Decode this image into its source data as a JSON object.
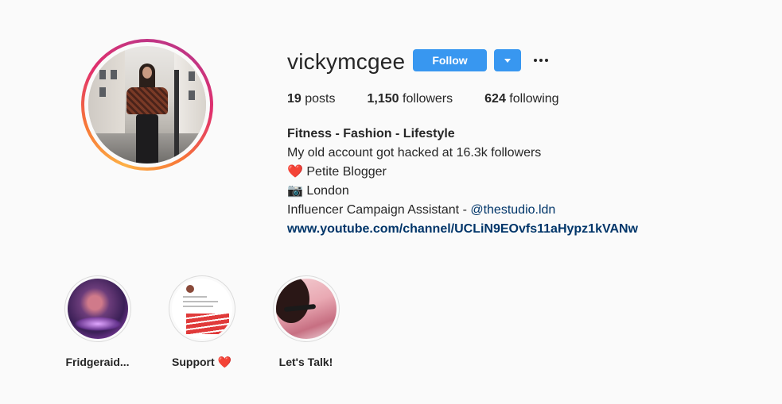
{
  "profile": {
    "username": "vickymcgee",
    "follow_label": "Follow",
    "stats": {
      "posts_count": "19",
      "posts_label": "posts",
      "followers_count": "1,150",
      "followers_label": "followers",
      "following_count": "624",
      "following_label": "following"
    },
    "bio": {
      "name": "Fitness - Fashion - Lifestyle",
      "line1": "My old account got hacked at 16.3k followers",
      "line2_emoji": "❤️",
      "line2_text": "Petite Blogger",
      "line3_emoji": "📷",
      "line3_text": "London",
      "line4_text": "Influencer Campaign Assistant - ",
      "line4_mention": "@thestudio.ldn",
      "link": "www.youtube.com/channel/UCLiN9EOvfs11aHypz1kVANw"
    }
  },
  "highlights": [
    {
      "label": "Fridgeraid..."
    },
    {
      "label": "Support",
      "emoji": "❤️"
    },
    {
      "label": "Let's Talk!"
    }
  ],
  "colors": {
    "accent": "#3897f0",
    "background": "#fafafa",
    "link": "#003569",
    "text": "#262626"
  }
}
